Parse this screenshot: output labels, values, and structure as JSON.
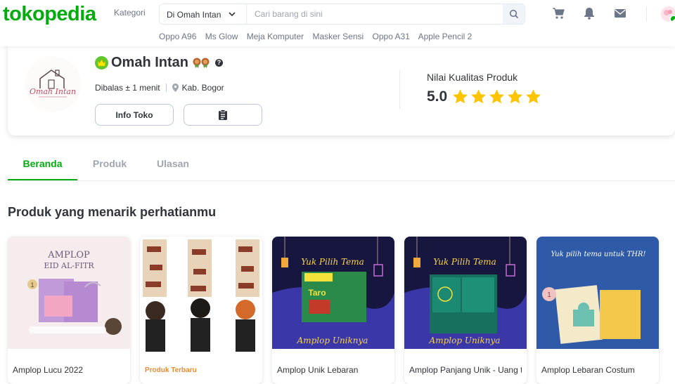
{
  "header": {
    "logo": "tokopedia",
    "kategori": "Kategori",
    "search_scope": "Di Omah Intan",
    "search_placeholder": "Cari barang di sini",
    "keywords": [
      "Oppo A96",
      "Ms Glow",
      "Meja Komputer",
      "Masker Sensi",
      "Oppo A31",
      "Apple Pencil 2"
    ]
  },
  "shop": {
    "name": "Omah Intan",
    "response": "Dibalas ± 1 menit",
    "location": "Kab. Bogor",
    "info_button": "Info Toko",
    "quality_label": "Nilai Kualitas Produk",
    "quality_score": "5.0",
    "rating_stars": 5,
    "logo_text": "Omah Intan"
  },
  "tabs": [
    "Beranda",
    "Produk",
    "Ulasan"
  ],
  "active_tab": "Beranda",
  "section_title": "Produk yang menarik perhatianmu",
  "products": [
    {
      "name": "Amplop Lucu 2022",
      "image_text": [
        "AMPLOP",
        "EID AL-FITR"
      ]
    },
    {
      "name": "",
      "tag": "Produk Terbaru"
    },
    {
      "name": "Amplop Unik Lebaran",
      "image_text": [
        "Yuk Pilih Tema",
        "Taro",
        "Amplop Uniknya"
      ]
    },
    {
      "name": "Amplop Panjang Unik - Uang t",
      "image_text": [
        "Yuk Pilih Tema",
        "Amplop Uniknya"
      ]
    },
    {
      "name": "Amplop Lebaran Costum",
      "image_text": [
        "Yuk pilih tema untuk THR!"
      ]
    }
  ],
  "colors": {
    "brand_green": "#03ac0e",
    "text": "#31353b",
    "muted": "#6d7588",
    "star": "#ffc400",
    "tag_orange": "#ef8a2c"
  }
}
